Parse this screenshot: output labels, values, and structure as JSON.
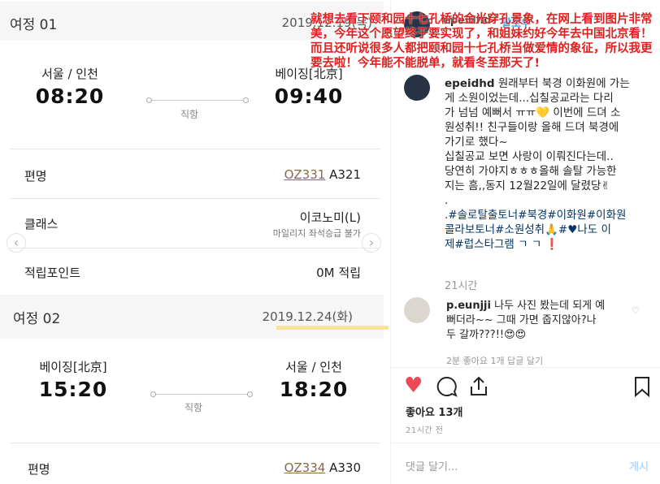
{
  "trip1": {
    "label": "여정 01",
    "date": "2019.12.19(목)",
    "origin": "서울 / 인천",
    "dep_time": "08:20",
    "dest": "베이징[北京]",
    "arr_time": "09:40",
    "direct": "직항",
    "flight_label": "편명",
    "flight_no": "OZ331",
    "aircraft": "A321",
    "class_label": "클래스",
    "class_value": "이코노미(L)",
    "class_sub": "마일리지 좌석승급 불가",
    "points_label": "적립포인트",
    "points_value": "0M 적립"
  },
  "trip2": {
    "label": "여정 02",
    "date": "2019.12.24(화)",
    "origin": "베이징[北京]",
    "dep_time": "15:20",
    "dest": "서울 / 인천",
    "arr_time": "18:20",
    "direct": "직항",
    "flight_label": "편명",
    "flight_no": "OZ334",
    "aircraft": "A330"
  },
  "nav": {
    "prev": "‹",
    "next": "›"
  },
  "instagram": {
    "author": "epeidhd",
    "follow": "팔로우",
    "bullet": "•",
    "caption_user": "epeidhd",
    "caption": " 원래부터 북경 이화원에 가는\n게 소원이었는데...십칠공교라는 다리\n가 넘넘 예뻐서 ㅠㅠ💛 이번에 드뎌 소\n원성취!! 친구들이랑 올해 드뎌 북경에\n가기로 했다~\n십칠공교 보면 사랑이 이뤄진다는데..\n당연히 가야지ㅎㅎㅎ올해 솔탈 가능한\n지는 흠,,동지 12월22일에 달렸당✌\n.\n.",
    "hashtags": "#솔로탈출토너#북경#이화원#이화원\n콜라보토너#소원성취🙏#♥나도 이\n제#럽스타그램 ㄱ ㄱ ❗",
    "caption_time": "21시간",
    "commenter": "p.eunjji",
    "comment_text": " 나두 사진 봤는데 되게 예\n뻐더라~~ 그때 가면 줍지않아?나\n두 갈까???!!😍😍",
    "replies": "2분     좋아요 1개     답글 달기",
    "likes": "좋아요 13개",
    "posted": "21시간 전",
    "comment_placeholder": "댓글 달기...",
    "post_button": "게시"
  },
  "overlay_text": "就想去看下颐和园十七孔桥的金光穿孔景象，在网上看到图片非常美，今年这个愿望终于要实现了，和姐妹约好今年去中国北京看！而且还听说很多人都把颐和园十七孔桥当做爱情的象征，所以我更要去啦！今年能不能脱单，就看冬至那天了!",
  "colors": {
    "highlight": "#f7e08a",
    "overlay_text": "#e02020",
    "like_heart": "#ed4956",
    "flight_link": "#8a6a3a"
  }
}
